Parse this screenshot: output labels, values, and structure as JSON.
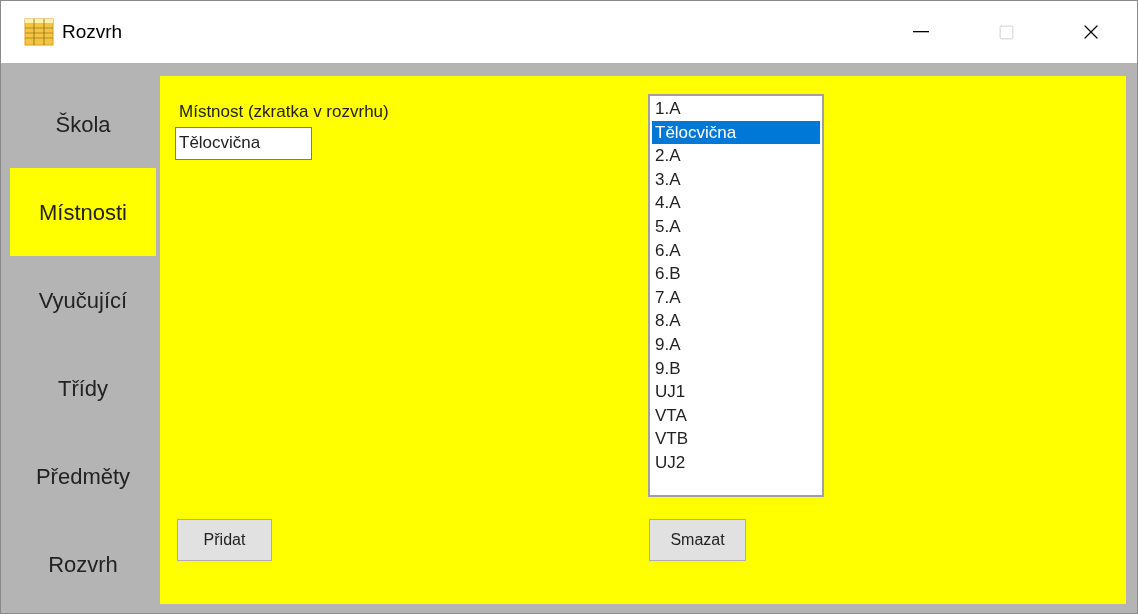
{
  "window": {
    "title": "Rozvrh"
  },
  "sidebar": {
    "items": [
      {
        "label": "Škola",
        "selected": false
      },
      {
        "label": "Místnosti",
        "selected": true
      },
      {
        "label": "Vyučující",
        "selected": false
      },
      {
        "label": "Třídy",
        "selected": false
      },
      {
        "label": "Předměty",
        "selected": false
      },
      {
        "label": "Rozvrh",
        "selected": false
      }
    ]
  },
  "form": {
    "label": "Místnost (zkratka v rozvrhu)",
    "value": "Tělocvična",
    "add_button": "Přidat"
  },
  "list": {
    "items": [
      {
        "label": "1.A",
        "selected": false
      },
      {
        "label": "Tělocvična",
        "selected": true
      },
      {
        "label": "2.A",
        "selected": false
      },
      {
        "label": "3.A",
        "selected": false
      },
      {
        "label": "4.A",
        "selected": false
      },
      {
        "label": "5.A",
        "selected": false
      },
      {
        "label": "6.A",
        "selected": false
      },
      {
        "label": "6.B",
        "selected": false
      },
      {
        "label": "7.A",
        "selected": false
      },
      {
        "label": "8.A",
        "selected": false
      },
      {
        "label": "9.A",
        "selected": false
      },
      {
        "label": "9.B",
        "selected": false
      },
      {
        "label": "UJ1",
        "selected": false
      },
      {
        "label": "VTA",
        "selected": false
      },
      {
        "label": "VTB",
        "selected": false
      },
      {
        "label": "UJ2",
        "selected": false
      }
    ],
    "delete_button": "Smazat"
  }
}
